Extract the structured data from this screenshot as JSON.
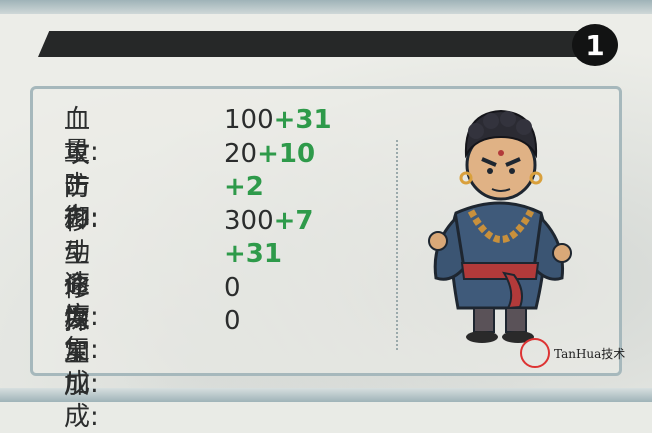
{
  "level": "1",
  "stats": [
    {
      "label": "血　量:",
      "base": "100",
      "bonus": "+31"
    },
    {
      "label": "攻击力:",
      "base": "20",
      "bonus": "+10"
    },
    {
      "label": "防　御:",
      "base": "",
      "bonus": "+2"
    },
    {
      "label": "移动速度:",
      "base": "300",
      "bonus": "+7"
    },
    {
      "label": "生命恢复:",
      "base": "",
      "bonus": "+31"
    },
    {
      "label": "修为加成:",
      "base": "0",
      "bonus": ""
    },
    {
      "label": "探宝加成:",
      "base": "0",
      "bonus": ""
    }
  ],
  "watermark": {
    "text": "TanHua技术"
  },
  "colors": {
    "bonus": "#2e9a4a",
    "text": "#2b2d2d",
    "title_bar": "#262828"
  }
}
